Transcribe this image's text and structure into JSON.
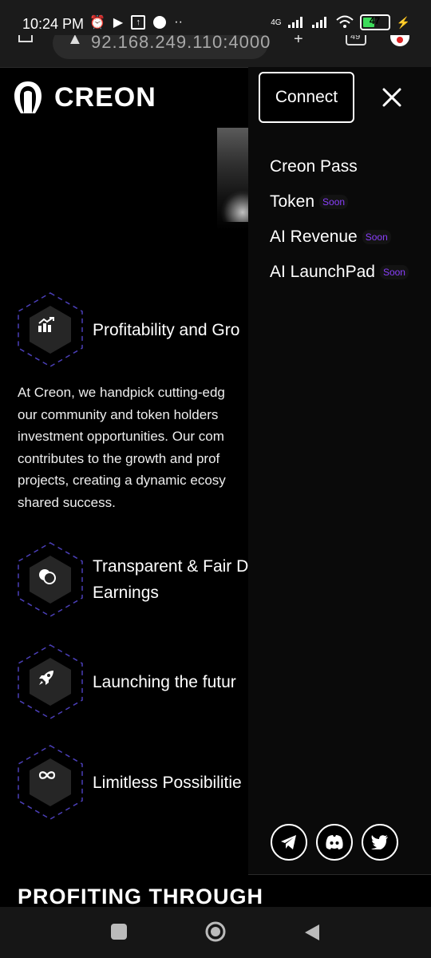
{
  "status_bar": {
    "time": "10:24 PM",
    "battery": "47",
    "network": "4G",
    "icons": [
      "alarm-icon",
      "play-icon",
      "upload-icon",
      "whatsapp-icon",
      "more-dots-icon",
      "signal-icon",
      "signal-icon",
      "wifi-icon",
      "battery-icon",
      "charging-icon"
    ]
  },
  "browser": {
    "url": "92.168.249.110:4000",
    "tab_count": "49",
    "icons": [
      "home-icon",
      "lock-icon",
      "plus-icon",
      "tabs-icon",
      "avatar-icon"
    ]
  },
  "site": {
    "brand": "CREON",
    "accent_color": "#8a3ffc"
  },
  "features": [
    {
      "title": "Profitability and Gro",
      "icon": "chart-icon"
    },
    {
      "title_line1": "Transparent & Fair D",
      "title_line2": "Earnings",
      "icon": "coins-icon"
    },
    {
      "title": "Launching the futur",
      "icon": "rocket-icon"
    },
    {
      "title": "Limitless Possibilitie",
      "icon": "infinity-icon"
    }
  ],
  "paragraph": {
    "lines": [
      "At Creon, we handpick cutting-edg",
      "our community and token holders",
      "investment opportunities. Our com",
      "contributes to the growth and prof",
      "projects, creating a dynamic ecosy",
      "shared success."
    ]
  },
  "section_heading": "PROFITING THROUGH",
  "menu": {
    "connect_label": "Connect",
    "items": [
      {
        "label": "Creon Pass",
        "badge": ""
      },
      {
        "label": "Token",
        "badge": "Soon"
      },
      {
        "label": "AI Revenue",
        "badge": "Soon"
      },
      {
        "label": "AI LaunchPad",
        "badge": "Soon"
      }
    ],
    "socials": [
      "telegram-icon",
      "discord-icon",
      "twitter-icon"
    ]
  },
  "system_nav": [
    "recents-icon",
    "home-icon",
    "back-icon"
  ]
}
